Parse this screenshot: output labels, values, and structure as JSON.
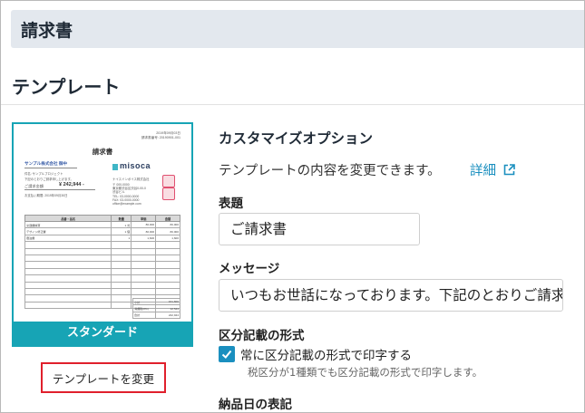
{
  "page": {
    "title": "請求書"
  },
  "section": {
    "title": "テンプレート"
  },
  "template": {
    "name": "スタンダード",
    "change_label": "テンプレートを変更",
    "preview": {
      "date_line1": "2019年09月03日",
      "date_line2": "請求書番号: 20190901-001",
      "doc_title": "請求書",
      "client": "サンプル株式会社 御中",
      "subject": "件名: サンプルプロジェクト",
      "note": "下記のとおりご請求申し上げます。",
      "amount_label": "ご請求金額",
      "amount_value": "¥ 242,944 -",
      "due": "お支払い期限: 2019年09月30日",
      "logo": "misoca",
      "company": "ナイスインボイス株式会社",
      "address1": "〒 000-0000",
      "address2": "東京都渋谷区渋谷0-00-0",
      "address3": "渋谷ビル",
      "tel": "TEL: 03-0000-0000",
      "fax": "FAX: 03-0000-0000",
      "email": "office@example.com",
      "table_headers": [
        "品番・品名",
        "数量",
        "単価",
        "金額"
      ],
      "rows": [
        {
          "name": "交通費精算",
          "qty": "1 式",
          "price": "80,000",
          "amount": "80,000"
        },
        {
          "name": "デザイン修正費",
          "qty": "1 個",
          "price": "80,000",
          "amount": "80,000"
        },
        {
          "name": "宿泊費",
          "qty": "1",
          "price": "1,600",
          "amount": "1,600"
        }
      ],
      "summary": [
        {
          "label": "小計",
          "value": "161,600"
        },
        {
          "label": "消費税(8%)",
          "value": "12,544"
        },
        {
          "label": "合計",
          "value": "242,944"
        }
      ]
    }
  },
  "options": {
    "title": "カスタマイズオプション",
    "description": "テンプレートの内容を変更できます。",
    "detail_link": "詳細",
    "subject_label": "表題",
    "subject_value": "ご請求書",
    "message_label": "メッセージ",
    "message_value": "いつもお世話になっております。下記のとおりご請求申し上げます。",
    "tax_label": "区分記載の形式",
    "tax_checkbox_label": "常に区分記載の形式で印字する",
    "tax_hint": "税区分が1種類でも区分記載の形式で印字します。",
    "delivery_label": "納品日の表記"
  },
  "colors": {
    "accent": "#17a4b5",
    "link": "#1a8fbf",
    "highlight": "#e0202c",
    "header_bg": "#e3e8ee"
  }
}
